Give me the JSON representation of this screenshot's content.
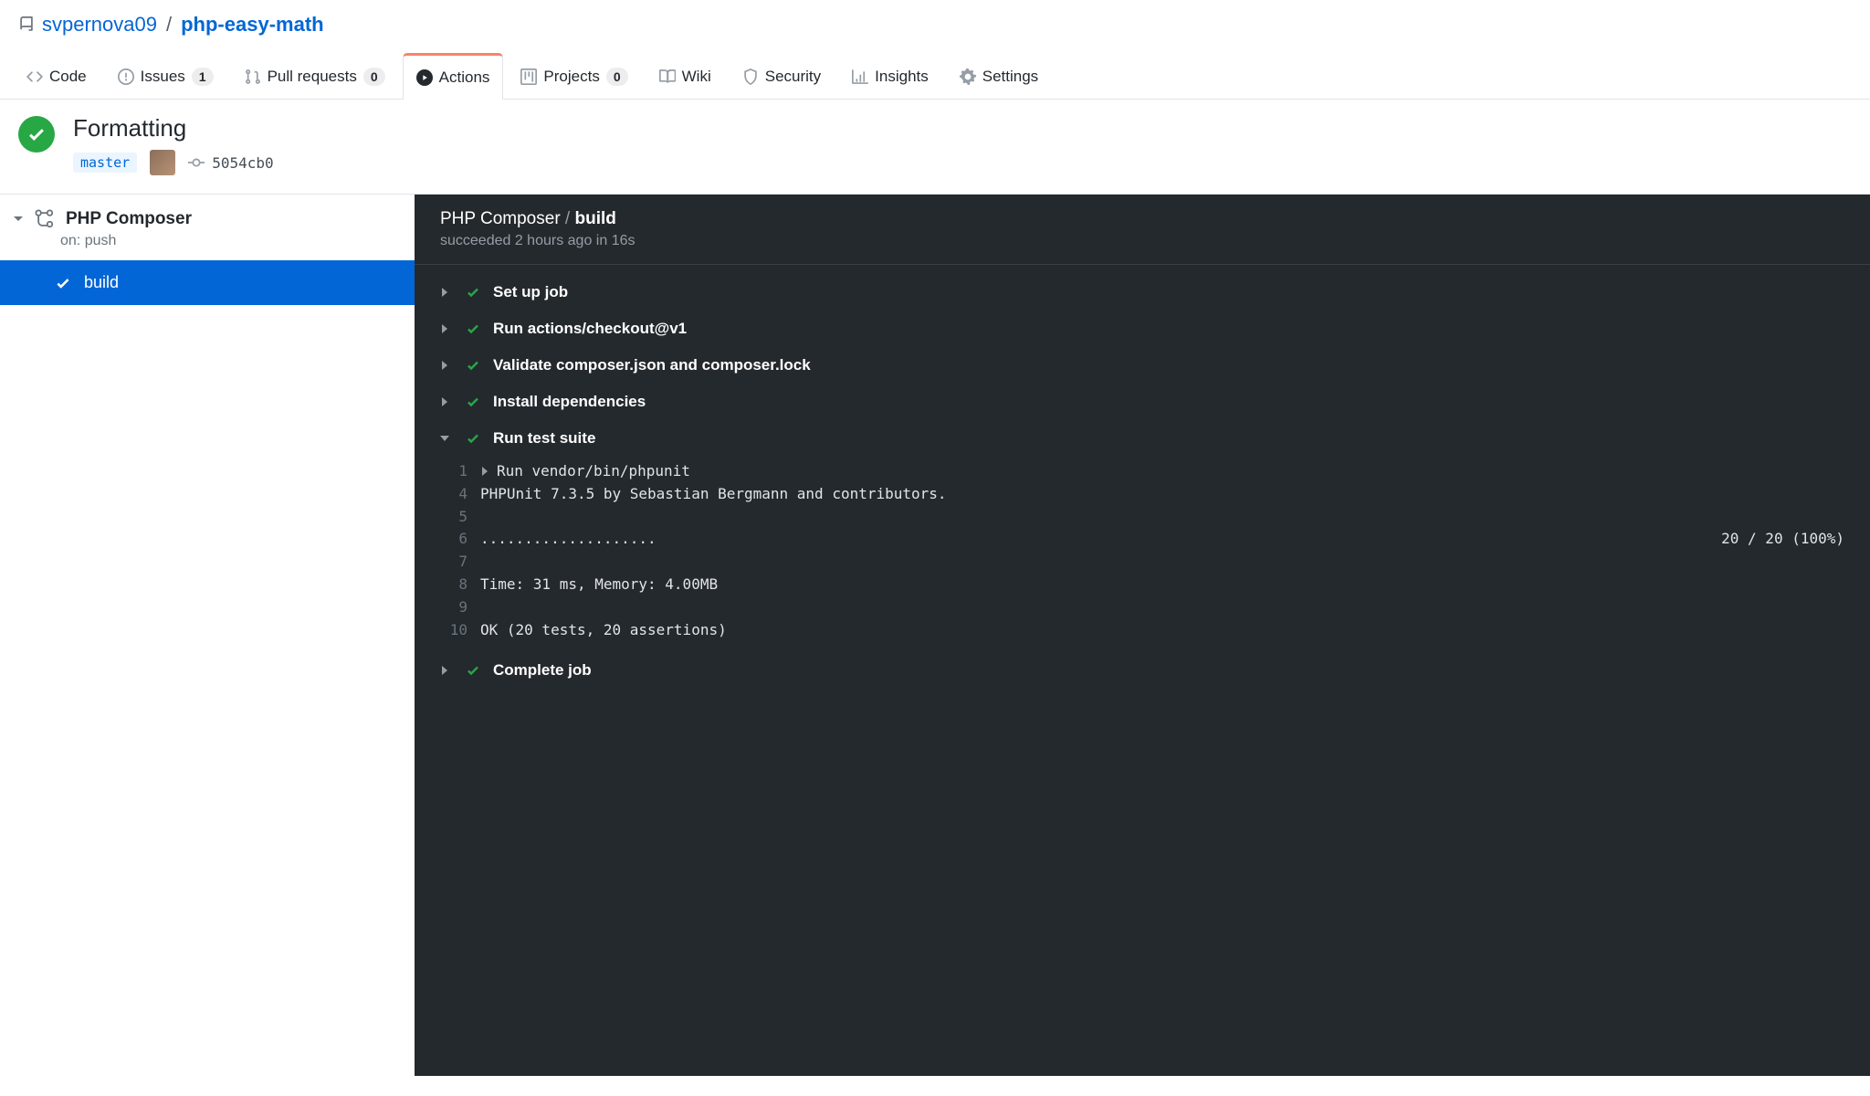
{
  "breadcrumb": {
    "owner": "svpernova09",
    "repo": "php-easy-math",
    "sep": "/"
  },
  "tabs": {
    "code": "Code",
    "issues": {
      "label": "Issues",
      "count": "1"
    },
    "pulls": {
      "label": "Pull requests",
      "count": "0"
    },
    "actions": "Actions",
    "projects": {
      "label": "Projects",
      "count": "0"
    },
    "wiki": "Wiki",
    "security": "Security",
    "insights": "Insights",
    "settings": "Settings"
  },
  "run": {
    "title": "Formatting",
    "branch": "master",
    "commit": "5054cb0"
  },
  "workflow": {
    "name": "PHP Composer",
    "trigger": "on: push",
    "job": "build"
  },
  "log": {
    "title_prefix": "PHP Composer",
    "title_sep": " / ",
    "title_job": "build",
    "status": "succeeded 2 hours ago in 16s",
    "steps": [
      {
        "label": "Set up job",
        "expanded": false
      },
      {
        "label": "Run actions/checkout@v1",
        "expanded": false
      },
      {
        "label": "Validate composer.json and composer.lock",
        "expanded": false
      },
      {
        "label": "Install dependencies",
        "expanded": false
      },
      {
        "label": "Run test suite",
        "expanded": true
      },
      {
        "label": "Complete job",
        "expanded": false
      }
    ],
    "lines": [
      {
        "n": "1",
        "t": "Run vendor/bin/phpunit",
        "caret": true
      },
      {
        "n": "4",
        "t": "PHPUnit 7.3.5 by Sebastian Bergmann and contributors."
      },
      {
        "n": "5",
        "t": ""
      },
      {
        "n": "6",
        "t": "....................",
        "r": "20 / 20 (100%)"
      },
      {
        "n": "7",
        "t": ""
      },
      {
        "n": "8",
        "t": "Time: 31 ms, Memory: 4.00MB"
      },
      {
        "n": "9",
        "t": ""
      },
      {
        "n": "10",
        "t": "OK (20 tests, 20 assertions)"
      }
    ]
  }
}
